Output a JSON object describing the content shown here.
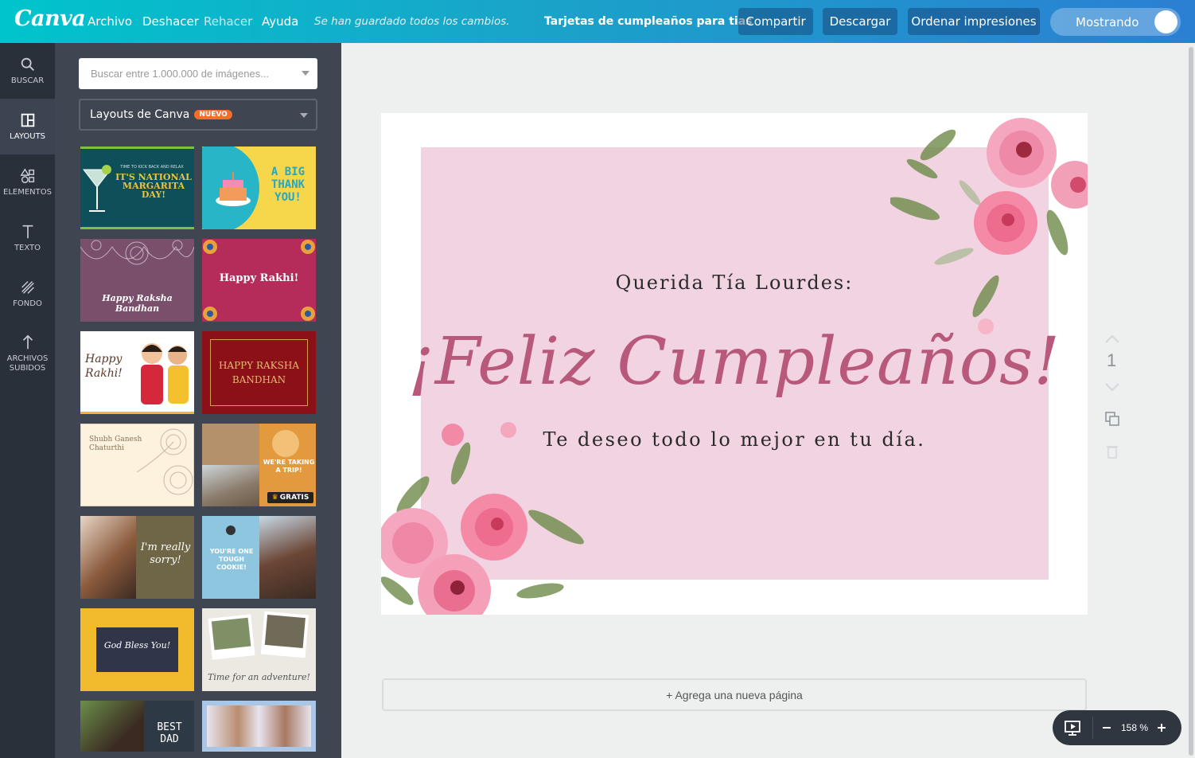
{
  "app": {
    "logo": "Canva",
    "menu": {
      "archivo": "Archivo",
      "deshacer": "Deshacer",
      "rehacer": "Rehacer",
      "ayuda": "Ayuda"
    },
    "saved_status": "Se han guardado todos los cambios.",
    "document_title": "Tarjetas de cumpleaños para tias",
    "buttons": {
      "share": "Compartir",
      "download": "Descargar",
      "order": "Ordenar impresiones"
    },
    "toggle_label": "Mostrando",
    "accent": "#00c4cc"
  },
  "rail": [
    {
      "label": "BUSCAR",
      "icon": "search-icon"
    },
    {
      "label": "LAYOUTS",
      "icon": "layout-icon",
      "active": true
    },
    {
      "label": "ELEMENTOS",
      "icon": "shapes-icon"
    },
    {
      "label": "TEXTO",
      "icon": "text-icon"
    },
    {
      "label": "FONDO",
      "icon": "background-pattern-icon"
    },
    {
      "label": "ARCHIVOS SUBIDOS",
      "icon": "upload-icon"
    }
  ],
  "panel": {
    "search_placeholder": "Buscar entre 1.000.000 de imágenes...",
    "dropdown_label": "Layouts de Canva",
    "dropdown_badge": "NUEVO",
    "thumbnails": [
      {
        "title": "IT'S NATIONAL MARGARITA DAY!",
        "kicker": "TIME TO KICK BACK AND RELAX"
      },
      {
        "title": "A BIG THANK YOU!"
      },
      {
        "title": "Happy Raksha Bandhan"
      },
      {
        "title": "Happy Rakhi!"
      },
      {
        "title": "Happy Rakhi!"
      },
      {
        "title": "HAPPY RAKSHA BANDHAN"
      },
      {
        "title": "Shubh Ganesh Chaturthi"
      },
      {
        "title": "WE'RE TAKING A TRIP!",
        "badge": "GRATIS"
      },
      {
        "title": "I'm really sorry!"
      },
      {
        "title": "YOU'RE ONE TOUGH COOKIE!"
      },
      {
        "title": "God Bless You!"
      },
      {
        "title": "Time for an adventure!"
      },
      {
        "title": "BEST DAD"
      },
      {
        "title": ""
      }
    ]
  },
  "card": {
    "greeting": "Querida Tía Lourdes:",
    "headline": "¡Feliz Cumpleaños!",
    "wish": "Te deseo todo lo mejor en tu día.",
    "background_color": "#f1d3e2",
    "headline_color": "#b8597b"
  },
  "canvas": {
    "page_number": "1",
    "add_page": "+ Agrega una nueva página",
    "zoom": "158 %"
  }
}
